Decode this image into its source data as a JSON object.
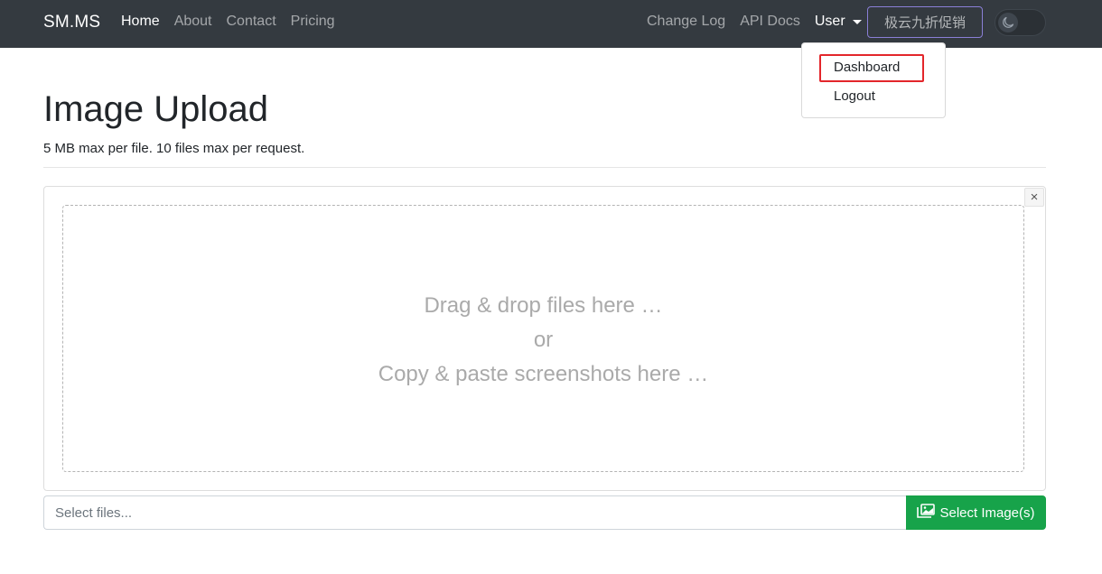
{
  "navbar": {
    "brand": "SM.MS",
    "left_links": [
      "Home",
      "About",
      "Contact",
      "Pricing"
    ],
    "right_links": [
      "Change Log",
      "API Docs"
    ],
    "user_label": "User",
    "promo_label": "极云九折促销"
  },
  "user_menu": {
    "items": [
      "Dashboard",
      "Logout"
    ]
  },
  "header": {
    "title": "Image Upload",
    "subtitle": "5 MB max per file. 10 files max per request."
  },
  "upload": {
    "close_glyph": "×",
    "drop_line1": "Drag & drop files here …",
    "drop_line2": "or",
    "drop_line3": "Copy & paste screenshots here …",
    "input_placeholder": "Select files...",
    "button_label": "Select Image(s)"
  },
  "colors": {
    "navbar_bg": "#343a40",
    "primary_green": "#17a34a",
    "highlight_red": "#e3262b",
    "promo_border": "#8a7fd6"
  }
}
